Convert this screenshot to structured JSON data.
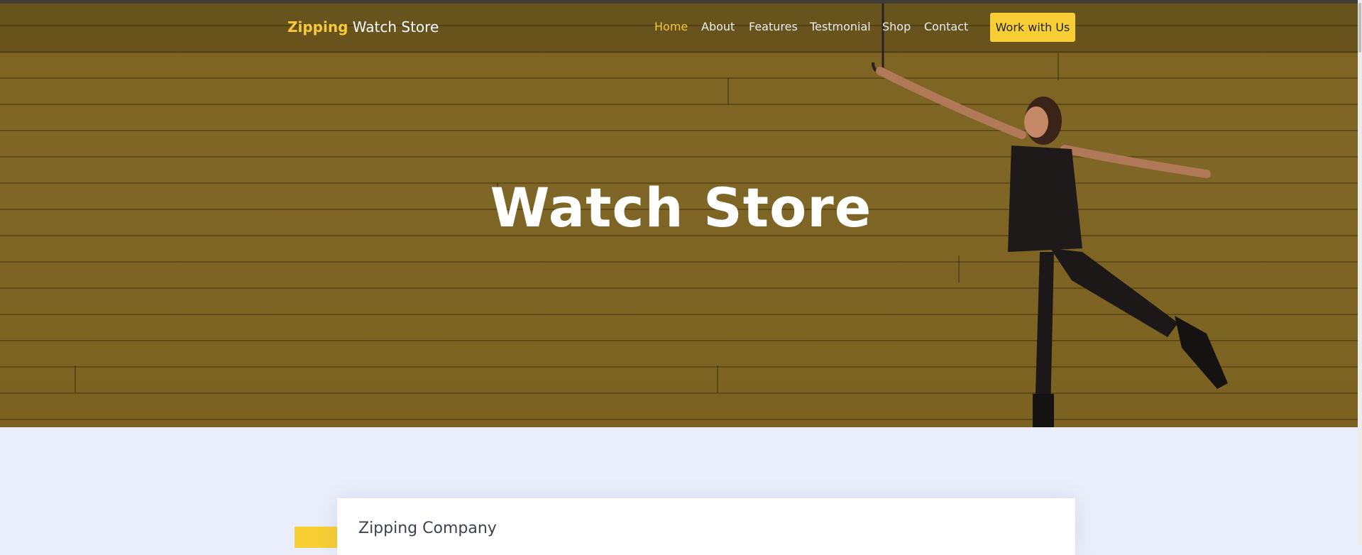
{
  "header": {
    "brand_accent": "Zipping",
    "brand_rest": " Watch Store",
    "nav": [
      "Home",
      "About",
      "Features",
      "Testmonial",
      "Shop",
      "Contact"
    ],
    "cta_label": "Work with Us"
  },
  "hero": {
    "title": "Watch Store"
  },
  "section": {
    "card_title": "Zipping Company"
  },
  "colors": {
    "accent": "#f7c93a",
    "hero_overlay": "#7d6422",
    "page_background": "#e9eefa"
  }
}
